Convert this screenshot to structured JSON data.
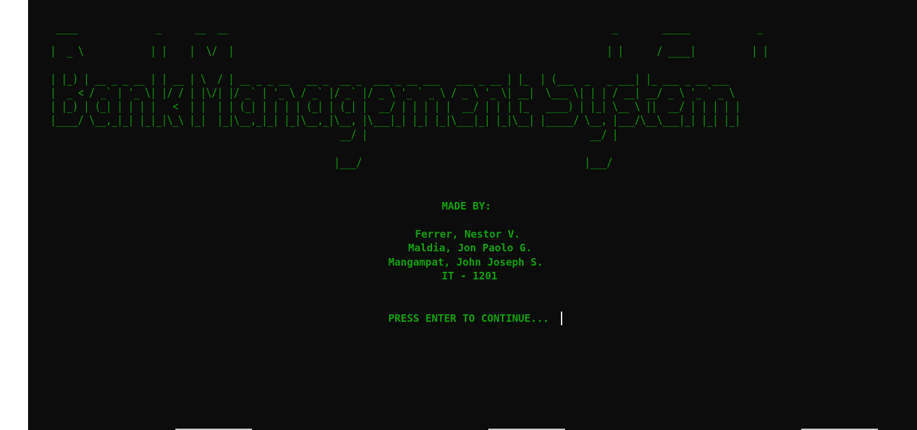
{
  "banner": {
    "lines": [
      "     ____              _      __  __                                                                     _        _____            _",
      "    |  _ \\            | |    |  \\/  |                                                                   | |      / ____|          | |",
      "    | |_) | __ _ _ __ | | __ | \\  / | __ _ _ __   __ _  __ _  ___ _ __ ___   ___ _ __ | |_  | (___  _   _ ___| |_ ___ _ __ ___",
      "    |  _ < / _` | '_ \\| |/ / | |\\/| |/ _` | '_ \\ / _` |/ _` |/ _ \\ '_ ` _ \\ / _ \\ '_ \\| __|  \\___ \\| | | / __| __/ _ \\ '_ ` _ \\",
      "    | |_) | (_| | | | |   <  | |  | | (_| | | | | (_| | (_| |  __/ | | | | |  __/ | | | |_   ____) | |_| \\__ \\ ||  __/ | | | | |",
      "    |____/ \\__,_|_| |_|_|\\_\\ |_|  |_|\\__,_|_| |_|\\__,_|\\__, |\\___|_| |_| |_|\\___|_| |_|\\__| |_____/ \\__, |___/\\__\\___|_| |_| |_|",
      "                                                        __/ |                                        __/ |",
      "                                                       |___/                                        |___/"
    ]
  },
  "credits": {
    "heading": "MADE BY:",
    "author_1": "Ferrer, Nestor V.",
    "author_2": "Maldia, Jon Paolo G.",
    "author_3": "Mangampat, John Joseph S.",
    "section": "IT - 1201"
  },
  "prompt": {
    "text": "PRESS ENTER TO CONTINUE..."
  },
  "colors": {
    "terminal_background": "#0c0c0c",
    "text": "#13a10e",
    "cursor": "#e6e6e6"
  }
}
